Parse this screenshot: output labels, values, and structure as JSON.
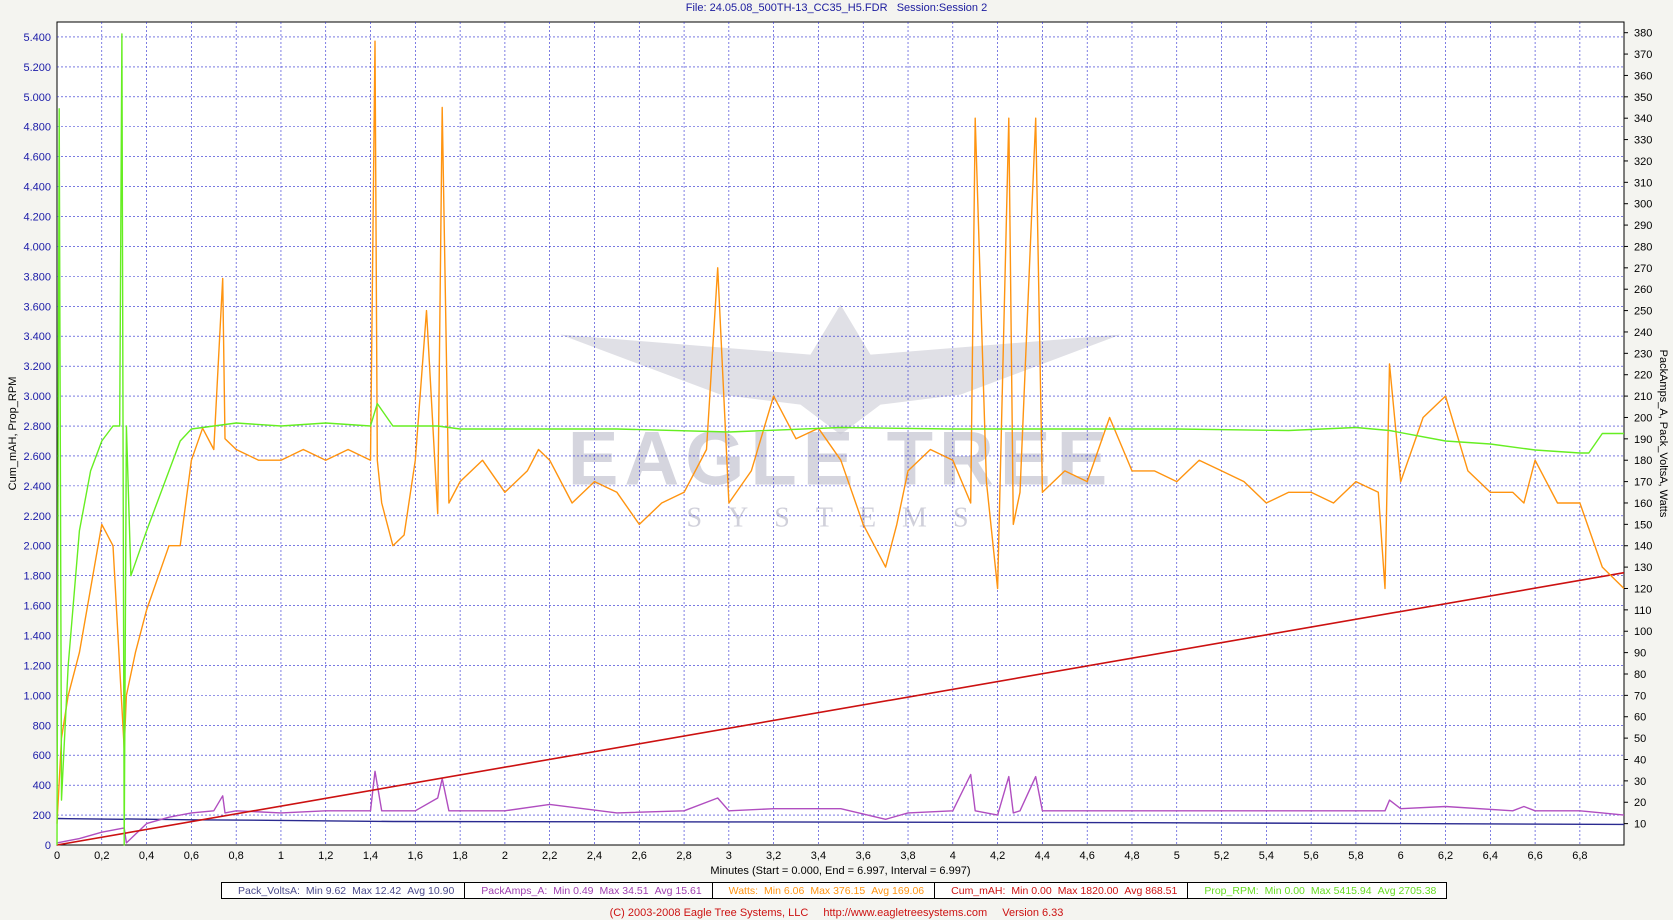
{
  "header": {
    "file_label": "File: 24.05.08_500TH-13_CC35_H5.FDR",
    "session_label": "Session:Session 2"
  },
  "footer": {
    "copyright": "(C) 2003-2008 Eagle Tree Systems, LLC",
    "url": "http://www.eagletreesystems.com",
    "version": "Version 6.33"
  },
  "watermark": {
    "brand": "EAGLE TREE",
    "sub": "SYSTEMS"
  },
  "chart_data": {
    "type": "line",
    "xlabel": "Minutes (Start = 0.000,  End = 6.997,  Interval =  6.997)",
    "ylabel_left": "Cum_mAH, Prop_RPM",
    "ylabel_right": "PackAmps_A, Pack_VoltsA, Watts",
    "xlim": [
      0,
      6.997
    ],
    "ylim_left": [
      0,
      5500
    ],
    "ylim_right": [
      0,
      385
    ],
    "x_ticks": [
      "0",
      "0,2",
      "0,4",
      "0,6",
      "0,8",
      "1",
      "1,2",
      "1,4",
      "1,6",
      "1,8",
      "2",
      "2,2",
      "2,4",
      "2,6",
      "2,8",
      "3",
      "3,2",
      "3,4",
      "3,6",
      "3,8",
      "4",
      "4,2",
      "4,4",
      "4,6",
      "4,8",
      "5",
      "5,2",
      "5,4",
      "5,6",
      "5,8",
      "6",
      "6,2",
      "6,4",
      "6,6",
      "6,8"
    ],
    "y_left_ticks": [
      "0",
      "200",
      "400",
      "600",
      "800",
      "1.000",
      "1.200",
      "1.400",
      "1.600",
      "1.800",
      "2.000",
      "2.200",
      "2.400",
      "2.600",
      "2.800",
      "3.000",
      "3.200",
      "3.400",
      "3.600",
      "3.800",
      "4.000",
      "4.200",
      "4.400",
      "4.600",
      "4.800",
      "5.000",
      "5.200",
      "5.400"
    ],
    "y_right_ticks": [
      "10",
      "20",
      "30",
      "40",
      "50",
      "60",
      "70",
      "80",
      "90",
      "100",
      "110",
      "120",
      "130",
      "140",
      "150",
      "160",
      "170",
      "180",
      "190",
      "200",
      "210",
      "220",
      "230",
      "240",
      "250",
      "260",
      "270",
      "280",
      "290",
      "300",
      "310",
      "320",
      "330",
      "340",
      "350",
      "360",
      "370",
      "380"
    ],
    "grid": true,
    "series": [
      {
        "name": "Prop_RPM",
        "axis": "left",
        "color": "#66ee22",
        "x": [
          0,
          0.01,
          0.02,
          0.03,
          0.05,
          0.1,
          0.15,
          0.2,
          0.25,
          0.28,
          0.29,
          0.3,
          0.31,
          0.33,
          0.4,
          0.5,
          0.55,
          0.6,
          0.8,
          1.0,
          1.2,
          1.4,
          1.43,
          1.5,
          1.7,
          1.8,
          2.0,
          2.5,
          3.0,
          3.5,
          4.0,
          4.5,
          5.0,
          5.5,
          5.8,
          5.95,
          6.2,
          6.4,
          6.6,
          6.8,
          6.84,
          6.9,
          6.997
        ],
        "y": [
          0,
          4920,
          300,
          600,
          1200,
          2100,
          2500,
          2700,
          2800,
          2800,
          5420,
          0,
          2800,
          1800,
          2100,
          2500,
          2700,
          2780,
          2820,
          2800,
          2820,
          2800,
          2950,
          2800,
          2800,
          2780,
          2780,
          2780,
          2760,
          2790,
          2780,
          2780,
          2780,
          2770,
          2790,
          2770,
          2700,
          2680,
          2640,
          2620,
          2620,
          2750,
          2750
        ]
      },
      {
        "name": "Watts",
        "axis": "right",
        "color": "#ff9410",
        "x": [
          0,
          0.02,
          0.05,
          0.1,
          0.15,
          0.2,
          0.25,
          0.3,
          0.31,
          0.35,
          0.4,
          0.5,
          0.55,
          0.6,
          0.65,
          0.7,
          0.74,
          0.75,
          0.8,
          0.9,
          1.0,
          1.1,
          1.2,
          1.3,
          1.4,
          1.42,
          1.43,
          1.45,
          1.5,
          1.55,
          1.6,
          1.65,
          1.7,
          1.72,
          1.75,
          1.8,
          1.9,
          2.0,
          2.1,
          2.15,
          2.2,
          2.3,
          2.4,
          2.5,
          2.6,
          2.7,
          2.8,
          2.9,
          2.95,
          3.0,
          3.1,
          3.2,
          3.3,
          3.4,
          3.5,
          3.6,
          3.7,
          3.75,
          3.8,
          3.9,
          4.0,
          4.08,
          4.1,
          4.15,
          4.2,
          4.25,
          4.27,
          4.3,
          4.37,
          4.4,
          4.5,
          4.6,
          4.7,
          4.8,
          4.9,
          5.0,
          5.1,
          5.2,
          5.3,
          5.4,
          5.5,
          5.6,
          5.7,
          5.8,
          5.9,
          5.93,
          5.95,
          6.0,
          6.1,
          6.2,
          6.3,
          6.4,
          6.5,
          6.55,
          6.6,
          6.7,
          6.8,
          6.9,
          6.997
        ],
        "y": [
          10,
          50,
          70,
          90,
          120,
          150,
          140,
          45,
          70,
          90,
          110,
          140,
          140,
          180,
          195,
          185,
          265,
          190,
          185,
          180,
          180,
          185,
          180,
          185,
          180,
          376,
          180,
          160,
          140,
          145,
          180,
          250,
          155,
          345,
          160,
          170,
          180,
          165,
          175,
          185,
          180,
          160,
          170,
          165,
          150,
          160,
          165,
          185,
          270,
          160,
          175,
          210,
          190,
          195,
          180,
          150,
          130,
          150,
          175,
          185,
          180,
          160,
          340,
          170,
          120,
          340,
          150,
          165,
          340,
          165,
          175,
          170,
          200,
          175,
          175,
          170,
          180,
          175,
          170,
          160,
          165,
          165,
          160,
          170,
          165,
          120,
          225,
          170,
          200,
          210,
          175,
          165,
          165,
          160,
          180,
          160,
          160,
          130,
          120
        ]
      },
      {
        "name": "Cum_mAH",
        "axis": "left",
        "color": "#cc1111",
        "x": [
          0,
          6.997
        ],
        "y": [
          0,
          1820
        ]
      },
      {
        "name": "PackAmps_A",
        "axis": "right",
        "color": "#b04ec0",
        "x": [
          0,
          0.05,
          0.1,
          0.2,
          0.3,
          0.31,
          0.4,
          0.5,
          0.6,
          0.7,
          0.74,
          0.75,
          0.8,
          1.0,
          1.2,
          1.4,
          1.42,
          1.45,
          1.6,
          1.7,
          1.72,
          1.75,
          2.0,
          2.2,
          2.5,
          2.8,
          2.95,
          3.0,
          3.2,
          3.5,
          3.7,
          3.8,
          4.0,
          4.08,
          4.1,
          4.2,
          4.25,
          4.27,
          4.3,
          4.37,
          4.4,
          4.5,
          5.0,
          5.5,
          5.93,
          5.95,
          6.0,
          6.2,
          6.5,
          6.55,
          6.6,
          6.8,
          6.9,
          6.997
        ],
        "y": [
          1,
          2,
          3,
          6,
          8,
          1,
          10,
          13,
          15,
          16,
          23,
          15,
          16,
          15,
          16,
          16,
          34.5,
          16,
          16,
          22,
          31,
          16,
          16,
          19,
          15,
          16,
          22,
          16,
          17,
          17,
          12,
          15,
          16,
          33,
          16,
          14,
          32,
          15,
          16,
          32,
          16,
          16,
          16,
          16,
          16,
          21,
          17,
          18,
          16,
          18,
          16,
          16,
          15,
          14
        ]
      },
      {
        "name": "Pack_VoltsA",
        "axis": "right",
        "color": "#2a2a90",
        "x": [
          0,
          0.05,
          0.3,
          0.31,
          0.6,
          1.0,
          1.5,
          2.0,
          3.0,
          4.0,
          5.0,
          6.0,
          6.997
        ],
        "y": [
          12.42,
          12.3,
          12.0,
          12.2,
          11.8,
          11.5,
          11.0,
          10.9,
          10.8,
          10.6,
          10.4,
          10.0,
          9.62
        ]
      }
    ]
  },
  "legend": [
    {
      "name": "Pack_VoltsA:",
      "min_label": "Min 9.62",
      "max_label": "Max 12.42",
      "avg_label": "Avg 10.90",
      "color": "#4a4a8a"
    },
    {
      "name": "PackAmps_A:",
      "min_label": "Min 0.49",
      "max_label": "Max 34.51",
      "avg_label": "Avg 15.61",
      "color": "#a040b0"
    },
    {
      "name": "Watts:",
      "min_label": "Min 6.06",
      "max_label": "Max 376.15",
      "avg_label": "Avg 169.06",
      "color": "#ff9410"
    },
    {
      "name": "Cum_mAH:",
      "min_label": "Min 0.00",
      "max_label": "Max 1820.00",
      "avg_label": "Avg 868.51",
      "color": "#cc1111"
    },
    {
      "name": "Prop_RPM:",
      "min_label": "Min 0.00",
      "max_label": "Max 5415.94",
      "avg_label": "Avg 2705.38",
      "color": "#66dd22"
    }
  ]
}
